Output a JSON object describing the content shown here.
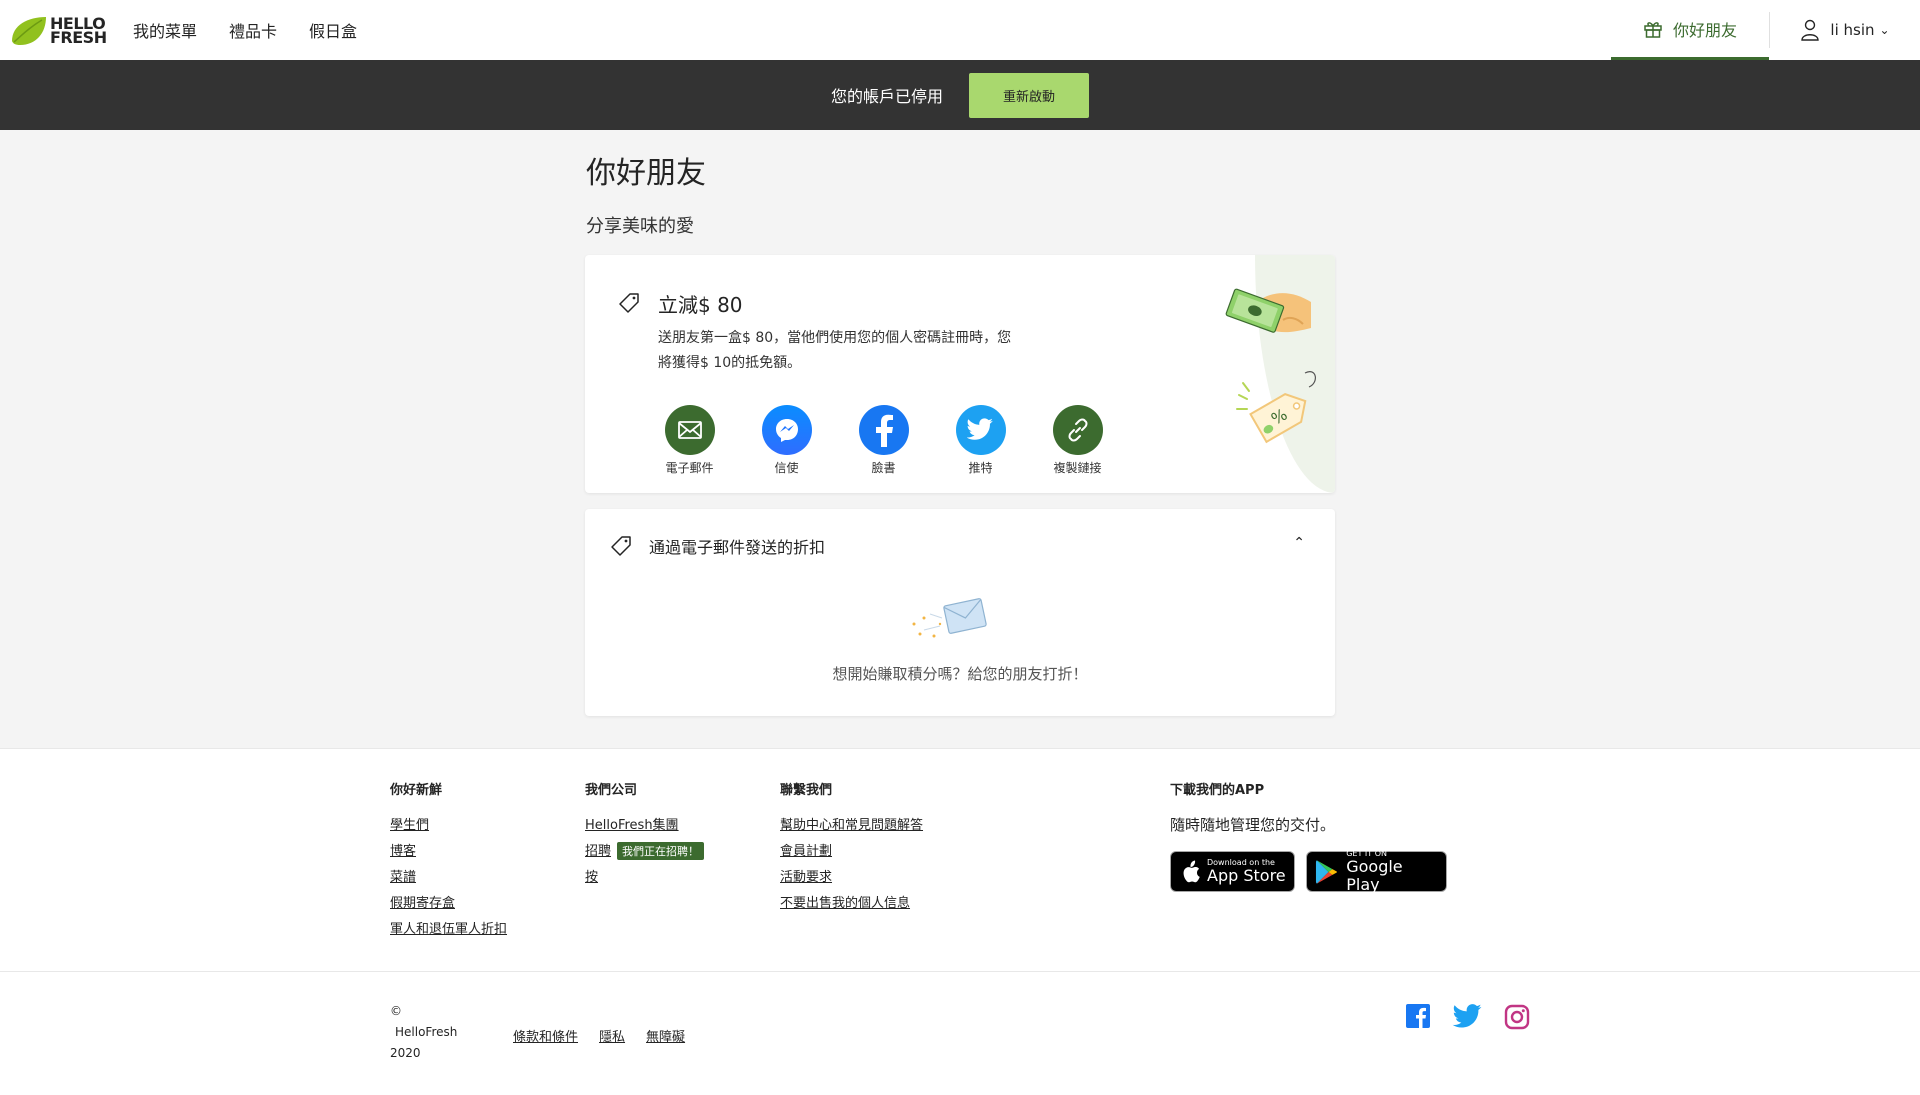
{
  "header": {
    "logo_line1": "HELLO",
    "logo_line2": "FRESH",
    "nav": [
      "我的菜單",
      "禮品卡",
      "假日盒"
    ],
    "friend_tab": "你好朋友",
    "user_name": "li hsin"
  },
  "banner": {
    "message": "您的帳戶已停用",
    "button": "重新啟動"
  },
  "main": {
    "title": "你好朋友",
    "subtitle": "分享美味的愛",
    "refer": {
      "title": "立減$ 80",
      "description": "送朋友第一盒$ 80，當他們使用您的個人密碼註冊時，您將獲得$ 10的抵免額。",
      "shares": [
        {
          "label": "電子郵件",
          "icon": "email-icon"
        },
        {
          "label": "信使",
          "icon": "messenger-icon"
        },
        {
          "label": "臉書",
          "icon": "facebook-icon"
        },
        {
          "label": "推特",
          "icon": "twitter-icon"
        },
        {
          "label": "複製鏈接",
          "icon": "link-icon"
        }
      ]
    },
    "email_discounts": {
      "title": "通過電子郵件發送的折扣",
      "empty": "想開始賺取積分嗎？給您的朋友打折！"
    }
  },
  "footer": {
    "col1": {
      "title": "你好新鮮",
      "links": [
        "學生們",
        "博客",
        "菜譜",
        "假期寄存盒",
        "軍人和退伍軍人折扣"
      ]
    },
    "col2": {
      "title": "我們公司",
      "links": [
        "HelloFresh集團",
        "招聘",
        "按"
      ],
      "hiring_badge": "我們正在招聘！"
    },
    "col3": {
      "title": "聯繫我們",
      "links": [
        "幫助中心和常見問題解答",
        "會員計劃",
        "活動要求",
        "不要出售我的個人信息"
      ]
    },
    "app": {
      "title": "下載我們的APP",
      "subtitle": "隨時隨地管理您的交付。",
      "appstore_small": "Download on the",
      "appstore_big": "App Store",
      "googleplay_small": "GET IT ON",
      "googleplay_big": "Google Play"
    },
    "copyright_symbol": "©",
    "copyright_name": "HelloFresh",
    "copyright_year": "2020",
    "legal": [
      "條款和條件",
      "隱私",
      "無障礙"
    ]
  },
  "colors": {
    "brand_green": "#3c6b2f",
    "lime": "#a9d86e",
    "banner_bg": "#333333",
    "facebook": "#1877f2",
    "twitter": "#1da1f2",
    "instagram": "#c13584"
  }
}
